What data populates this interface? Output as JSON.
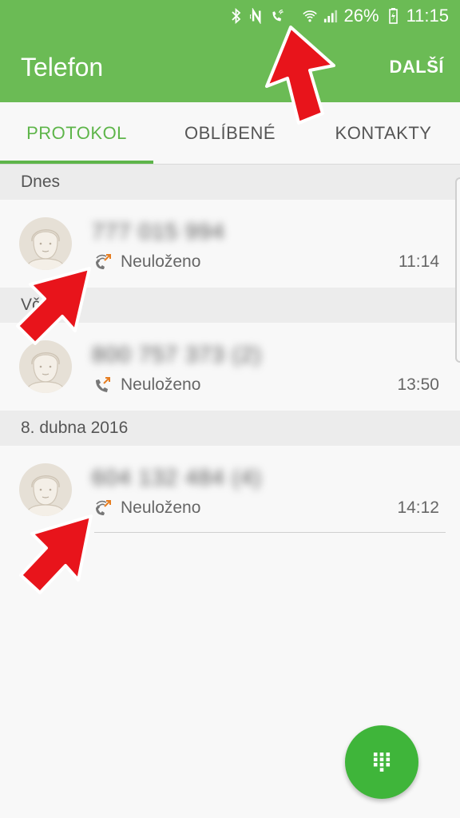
{
  "status_bar": {
    "battery_percent": "26%",
    "clock": "11:15",
    "icons": [
      "bluetooth-icon",
      "nfc-icon",
      "wifi-calling-icon",
      "wifi-icon",
      "signal-icon",
      "battery-charging-icon"
    ]
  },
  "app_bar": {
    "title": "Telefon",
    "more_label": "DALŠÍ",
    "color": "#6bbb55"
  },
  "tabs": [
    {
      "label": "PROTOKOL",
      "active": true
    },
    {
      "label": "OBLÍBENÉ",
      "active": false
    },
    {
      "label": "KONTAKTY",
      "active": false
    }
  ],
  "sections": [
    {
      "header": "Dnes",
      "calls": [
        {
          "number": "777 015 994",
          "status": "Neuloženo",
          "time": "11:14",
          "call_icon": "wifi-call-outgoing-icon"
        }
      ]
    },
    {
      "header": "Vč",
      "calls": [
        {
          "number": "800 757 373 (2)",
          "status": "Neuloženo",
          "time": "13:50",
          "call_icon": "phone-outgoing-icon"
        }
      ]
    },
    {
      "header": "8. dubna 2016",
      "calls": [
        {
          "number": "604 132 484 (4)",
          "status": "Neuloženo",
          "time": "14:12",
          "call_icon": "wifi-call-outgoing-icon"
        }
      ]
    }
  ],
  "fab": {
    "icon": "dialpad-icon",
    "color": "#3fb53a"
  },
  "annotation_color": "#e8141b"
}
